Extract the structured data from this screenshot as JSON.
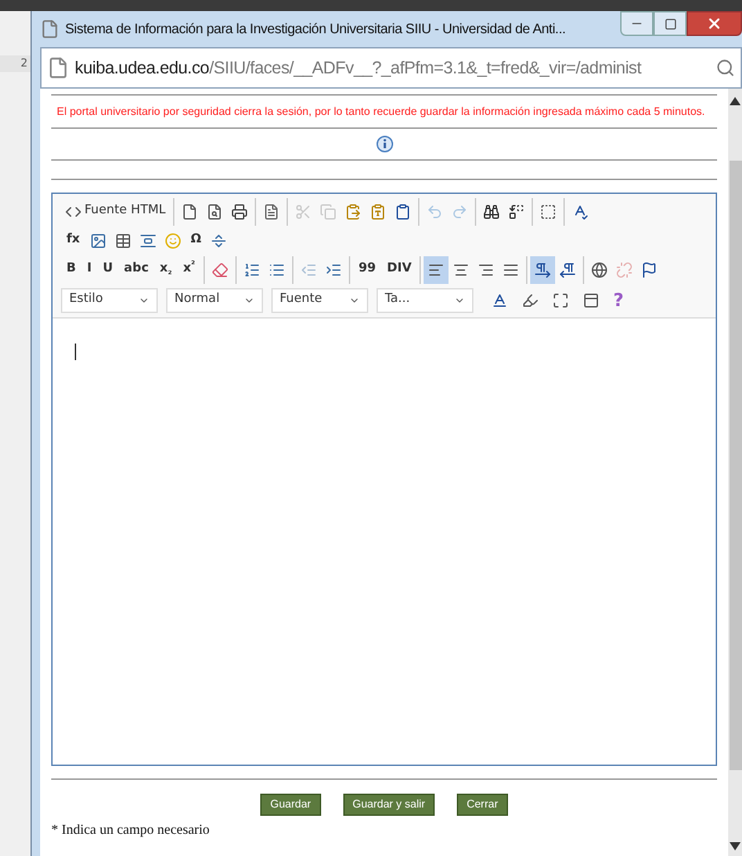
{
  "background": {
    "tab_label": "2"
  },
  "window": {
    "title": "Sistema de Información para la Investigación Universitaria SIIU - Universidad de Anti..."
  },
  "address_bar": {
    "host": "kuiba.udea.edu.co",
    "path": "/SIIU/faces/__ADFv__?_afPfm=3.1&_t=fred&_vir=/administ"
  },
  "notice": "El portal universitario por seguridad cierra la sesión, por lo tanto recuerde guardar la información ingresada máximo cada 5 minutos.",
  "editor": {
    "toolbar_rows": [
      [
        [
          {
            "kind": "icon",
            "label": "Fuente HTML",
            "selected": false,
            "disabled": false
          }
        ],
        [
          {
            "kind": "icon",
            "selected": false,
            "disabled": false
          },
          {
            "kind": "icon",
            "selected": false,
            "disabled": false
          },
          {
            "kind": "icon",
            "selected": false,
            "disabled": false
          }
        ],
        [
          {
            "kind": "icon",
            "selected": false,
            "disabled": false
          }
        ],
        [
          {
            "kind": "icon",
            "selected": false,
            "disabled": true
          },
          {
            "kind": "icon",
            "selected": false,
            "disabled": true
          },
          {
            "kind": "icon",
            "selected": false,
            "disabled": false
          },
          {
            "kind": "icon",
            "selected": false,
            "disabled": false
          },
          {
            "kind": "icon",
            "selected": false,
            "disabled": false
          }
        ],
        [
          {
            "kind": "icon",
            "selected": false,
            "disabled": true
          },
          {
            "kind": "icon",
            "selected": false,
            "disabled": true
          }
        ],
        [
          {
            "kind": "icon",
            "selected": false,
            "disabled": false
          },
          {
            "kind": "icon",
            "selected": false,
            "disabled": false
          }
        ],
        [
          {
            "kind": "icon",
            "selected": false,
            "disabled": false
          }
        ],
        [
          {
            "kind": "icon",
            "selected": false,
            "disabled": false
          }
        ]
      ],
      [
        [
          {
            "kind": "text",
            "label": "fx",
            "selected": false,
            "disabled": false
          },
          {
            "kind": "icon",
            "selected": false,
            "disabled": false
          },
          {
            "kind": "icon",
            "selected": false,
            "disabled": false
          },
          {
            "kind": "icon",
            "selected": false,
            "disabled": false
          },
          {
            "kind": "icon",
            "selected": false,
            "disabled": false
          },
          {
            "kind": "text",
            "label": "Ω",
            "selected": false,
            "disabled": false
          },
          {
            "kind": "icon",
            "selected": false,
            "disabled": false
          }
        ]
      ],
      [
        [
          {
            "kind": "text",
            "label": "B",
            "selected": false,
            "disabled": false
          },
          {
            "kind": "text",
            "label": "I",
            "selected": false,
            "disabled": false
          },
          {
            "kind": "text",
            "label": "U",
            "selected": false,
            "disabled": false
          },
          {
            "kind": "text",
            "label": "abc",
            "selected": false,
            "disabled": false
          },
          {
            "kind": "text",
            "label": "x$_{₂}$",
            "selected": false,
            "disabled": false
          },
          {
            "kind": "text",
            "label": "x$^{²}$",
            "selected": false,
            "disabled": false
          }
        ],
        [
          {
            "kind": "icon",
            "selected": false,
            "disabled": false
          }
        ],
        [
          {
            "kind": "icon",
            "selected": false,
            "disabled": false
          },
          {
            "kind": "icon",
            "selected": false,
            "disabled": false
          }
        ],
        [
          {
            "kind": "icon",
            "selected": false,
            "disabled": true
          },
          {
            "kind": "icon",
            "selected": false,
            "disabled": false
          }
        ],
        [
          {
            "kind": "text",
            "label": "99",
            "selected": false,
            "disabled": false
          },
          {
            "kind": "text",
            "label": "DIV",
            "selected": false,
            "disabled": false
          }
        ],
        [
          {
            "kind": "icon",
            "selected": true,
            "disabled": false
          },
          {
            "kind": "icon",
            "selected": false,
            "disabled": false
          },
          {
            "kind": "icon",
            "selected": false,
            "disabled": false
          },
          {
            "kind": "icon",
            "selected": false,
            "disabled": false
          }
        ],
        [
          {
            "kind": "icon",
            "selected": true,
            "disabled": false
          },
          {
            "kind": "icon",
            "selected": false,
            "disabled": false
          }
        ],
        [
          {
            "kind": "icon",
            "selected": false,
            "disabled": false
          },
          {
            "kind": "icon",
            "selected": false,
            "disabled": true
          },
          {
            "kind": "icon",
            "selected": false,
            "disabled": false
          }
        ]
      ]
    ],
    "combos": [
      "Estilo",
      "Normal",
      "Fuente",
      "Ta..."
    ],
    "tools": [
      {
        "kind": "icon"
      },
      {
        "kind": "icon"
      },
      {
        "kind": "icon"
      },
      {
        "kind": "icon"
      },
      {
        "kind": "text",
        "label": "?"
      }
    ]
  },
  "buttons": [
    "Guardar",
    "Guardar y salir",
    "Cerrar"
  ],
  "footnote": "* Indica un campo necesario"
}
